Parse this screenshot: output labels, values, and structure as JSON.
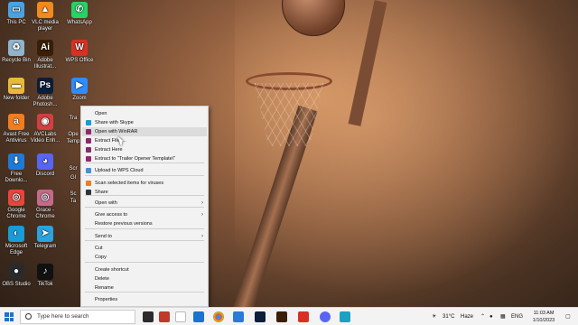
{
  "desktop": {
    "icons": [
      {
        "label": "This PC",
        "glyph": "▭",
        "color": "#4aa3e0"
      },
      {
        "label": "VLC media player",
        "glyph": "▲",
        "color": "#f08a1c"
      },
      {
        "label": "WhatsApp",
        "glyph": "✆",
        "color": "#25d366"
      },
      {
        "label": "Recycle Bin",
        "glyph": "♻",
        "color": "#8fb4cc"
      },
      {
        "label": "Adobe Illustrat...",
        "glyph": "Ai",
        "color": "#3a1e05"
      },
      {
        "label": "WPS Office",
        "glyph": "W",
        "color": "#d93025"
      },
      {
        "label": "New folder",
        "glyph": "▬",
        "color": "#e8b93a"
      },
      {
        "label": "Adobe Photosh...",
        "glyph": "Ps",
        "color": "#0b1e3a"
      },
      {
        "label": "Zoom",
        "glyph": "▶",
        "color": "#2d8cff"
      },
      {
        "label": "Avast Free Antivirus",
        "glyph": "a",
        "color": "#f27d1e"
      },
      {
        "label": "AVCLabs Video Enh...",
        "glyph": "◉",
        "color": "#d04040"
      },
      {
        "label": "Free Downlo...",
        "glyph": "⬇",
        "color": "#1e7ad8"
      },
      {
        "label": "Discord",
        "glyph": "◕",
        "color": "#5865f2"
      },
      {
        "label": "Google Chrome",
        "glyph": "◎",
        "color": "#e8453c"
      },
      {
        "label": "Grace - Chrome",
        "glyph": "◎",
        "color": "#c46a8c"
      },
      {
        "label": "Microsoft Edge",
        "glyph": "◐",
        "color": "#1a9ad6"
      },
      {
        "label": "Telegram",
        "glyph": "➤",
        "color": "#2aa3df"
      },
      {
        "label": "OBS Studio",
        "glyph": "●",
        "color": "#2a2a2a"
      },
      {
        "label": "TikTok",
        "glyph": "♪",
        "color": "#111111"
      }
    ]
  },
  "context_menu": {
    "items": [
      {
        "label": "Open",
        "icon": "none"
      },
      {
        "label": "Share with Skype",
        "icon": "skype-icon",
        "color": "#1a9ad6"
      },
      {
        "label": "Open with WinRAR",
        "icon": "winrar-icon",
        "color": "#8a2a6a"
      },
      {
        "label": "Extract Files...",
        "icon": "winrar-icon",
        "color": "#8a2a6a"
      },
      {
        "label": "Extract Here",
        "icon": "winrar-icon",
        "color": "#8a2a6a"
      },
      {
        "label": "Extract to \"Trailer Opener Template\\\"",
        "icon": "winrar-icon",
        "color": "#8a2a6a"
      },
      {
        "label": "Upload to WPS Cloud",
        "icon": "cloud-icon",
        "color": "#4a90d0"
      },
      {
        "label": "Scan selected items for viruses",
        "icon": "avast-icon",
        "color": "#f27d1e"
      },
      {
        "label": "Share",
        "icon": "share-icon",
        "color": "#333333"
      },
      {
        "label": "Open with",
        "icon": "none",
        "submenu": true
      },
      {
        "label": "Give access to",
        "icon": "none",
        "submenu": true
      },
      {
        "label": "Restore previous versions",
        "icon": "none"
      },
      {
        "label": "Send to",
        "icon": "none",
        "submenu": true
      },
      {
        "label": "Cut",
        "icon": "none"
      },
      {
        "label": "Copy",
        "icon": "none"
      },
      {
        "label": "Create shortcut",
        "icon": "none"
      },
      {
        "label": "Delete",
        "icon": "none"
      },
      {
        "label": "Rename",
        "icon": "none"
      },
      {
        "label": "Properties",
        "icon": "none"
      }
    ],
    "highlighted_index": 2
  },
  "partial_icon_labels": [
    "Tra",
    "Ope",
    "Temp",
    "Scr",
    "Gl",
    "Sc",
    "Ta"
  ],
  "taskbar": {
    "search_placeholder": "Type here to search",
    "weather": "31°C",
    "weather_desc": "Haze",
    "language": "ENG",
    "time": "11:03 AM",
    "date": "1/10/2023"
  }
}
